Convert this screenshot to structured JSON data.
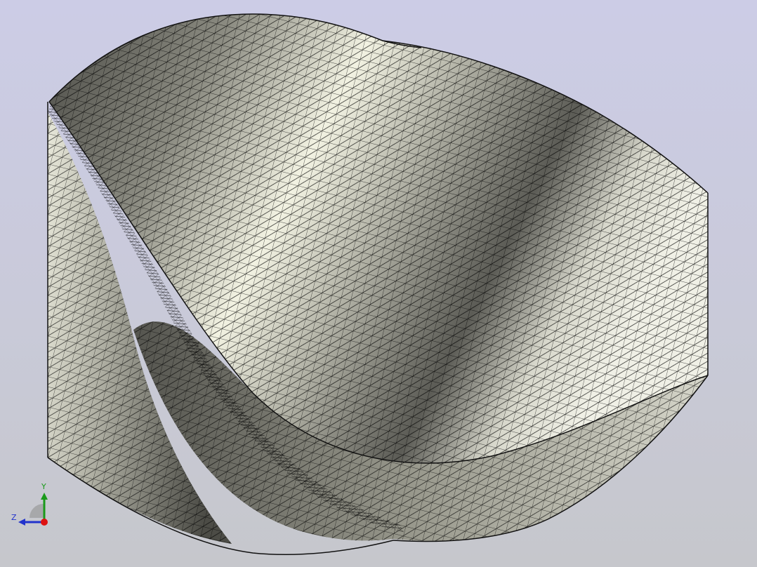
{
  "viewer": {
    "background_top": "#cccce6",
    "background_bottom": "#c6c7cc",
    "model": {
      "shape": "twisted-helical-surface-mesh",
      "render_mode": "shaded-with-edges",
      "edge_color": "#000000",
      "shade_dark": "#3c3c38",
      "shade_light": "#f4f4e6"
    }
  },
  "triad": {
    "y_label": "Y",
    "z_label": "Z",
    "y_color": "#1a9a1a",
    "z_color": "#2233cc",
    "x_color": "#dd1111"
  }
}
